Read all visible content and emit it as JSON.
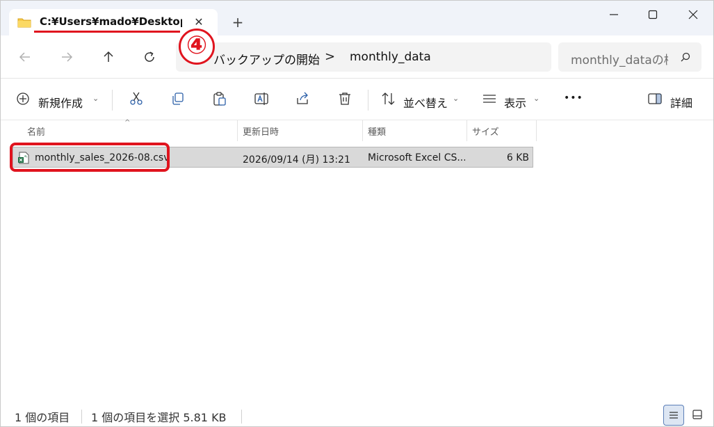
{
  "tab": {
    "title": "C:¥Users¥mado¥Desktop¥",
    "close_glyph": "✕"
  },
  "newtab_glyph": "+",
  "annotation": {
    "number": "④"
  },
  "address": {
    "crumbs": [
      "バックアップの開始",
      "monthly_data"
    ],
    "separator": ">",
    "search_placeholder": "monthly_dataの検索"
  },
  "commands": {
    "new": "新規作成",
    "sort": "並べ替え",
    "view": "表示",
    "more": "•••",
    "details": "詳細"
  },
  "columns": [
    "名前",
    "更新日時",
    "種類",
    "サイズ"
  ],
  "files": [
    {
      "name": "monthly_sales_2026-08.csv",
      "modified": "2026/09/14 (月) 13:21",
      "type": "Microsoft Excel CS...",
      "size": "6 KB",
      "selected": true
    }
  ],
  "status": {
    "count": "1 個の項目",
    "selection": "1 個の項目を選択  5.81 KB"
  },
  "colors": {
    "accent_red": "#e0141e",
    "selection_bg": "#d9d9d9"
  }
}
